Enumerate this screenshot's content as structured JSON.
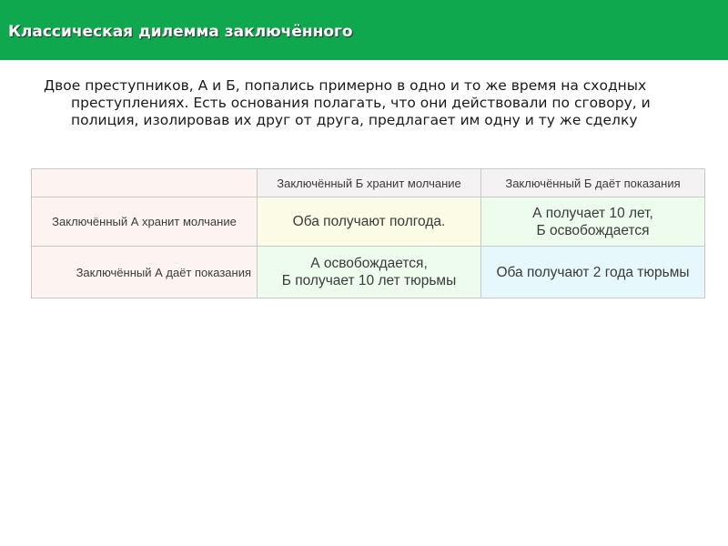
{
  "header": {
    "title": "Классическая дилемма заключённого",
    "background": "#10a84e"
  },
  "intro": {
    "text": "Двое преступников, А и Б, попались примерно в одно и то же время на сходных преступлениях. Есть основания полагать, что они действовали по сговору, и полиция, изолировав их друг от друга, предлагает им одну и ту же сделку"
  },
  "matrix": {
    "column_headers": [
      "",
      "Заключённый Б хранит молчание",
      "Заключённый Б даёт показания"
    ],
    "rows": [
      {
        "header": "Заключённый А хранит молчание",
        "cells": [
          "Оба получают полгода.",
          "А получает 10 лет,\nБ освобождается"
        ]
      },
      {
        "header": "Заключённый А даёт показания",
        "cells": [
          "А освобождается,\nБ получает 10 лет тюрьмы",
          "Оба получают 2 года тюрьмы"
        ]
      }
    ],
    "colors": {
      "header_cells": "#f4f2f2",
      "row_header_cells": "#fdf4f1",
      "silent_silent": "#fcfbe6",
      "silent_testify": "#eefcee",
      "testify_silent": "#eefcee",
      "testify_testify": "#e6f8fc"
    }
  }
}
